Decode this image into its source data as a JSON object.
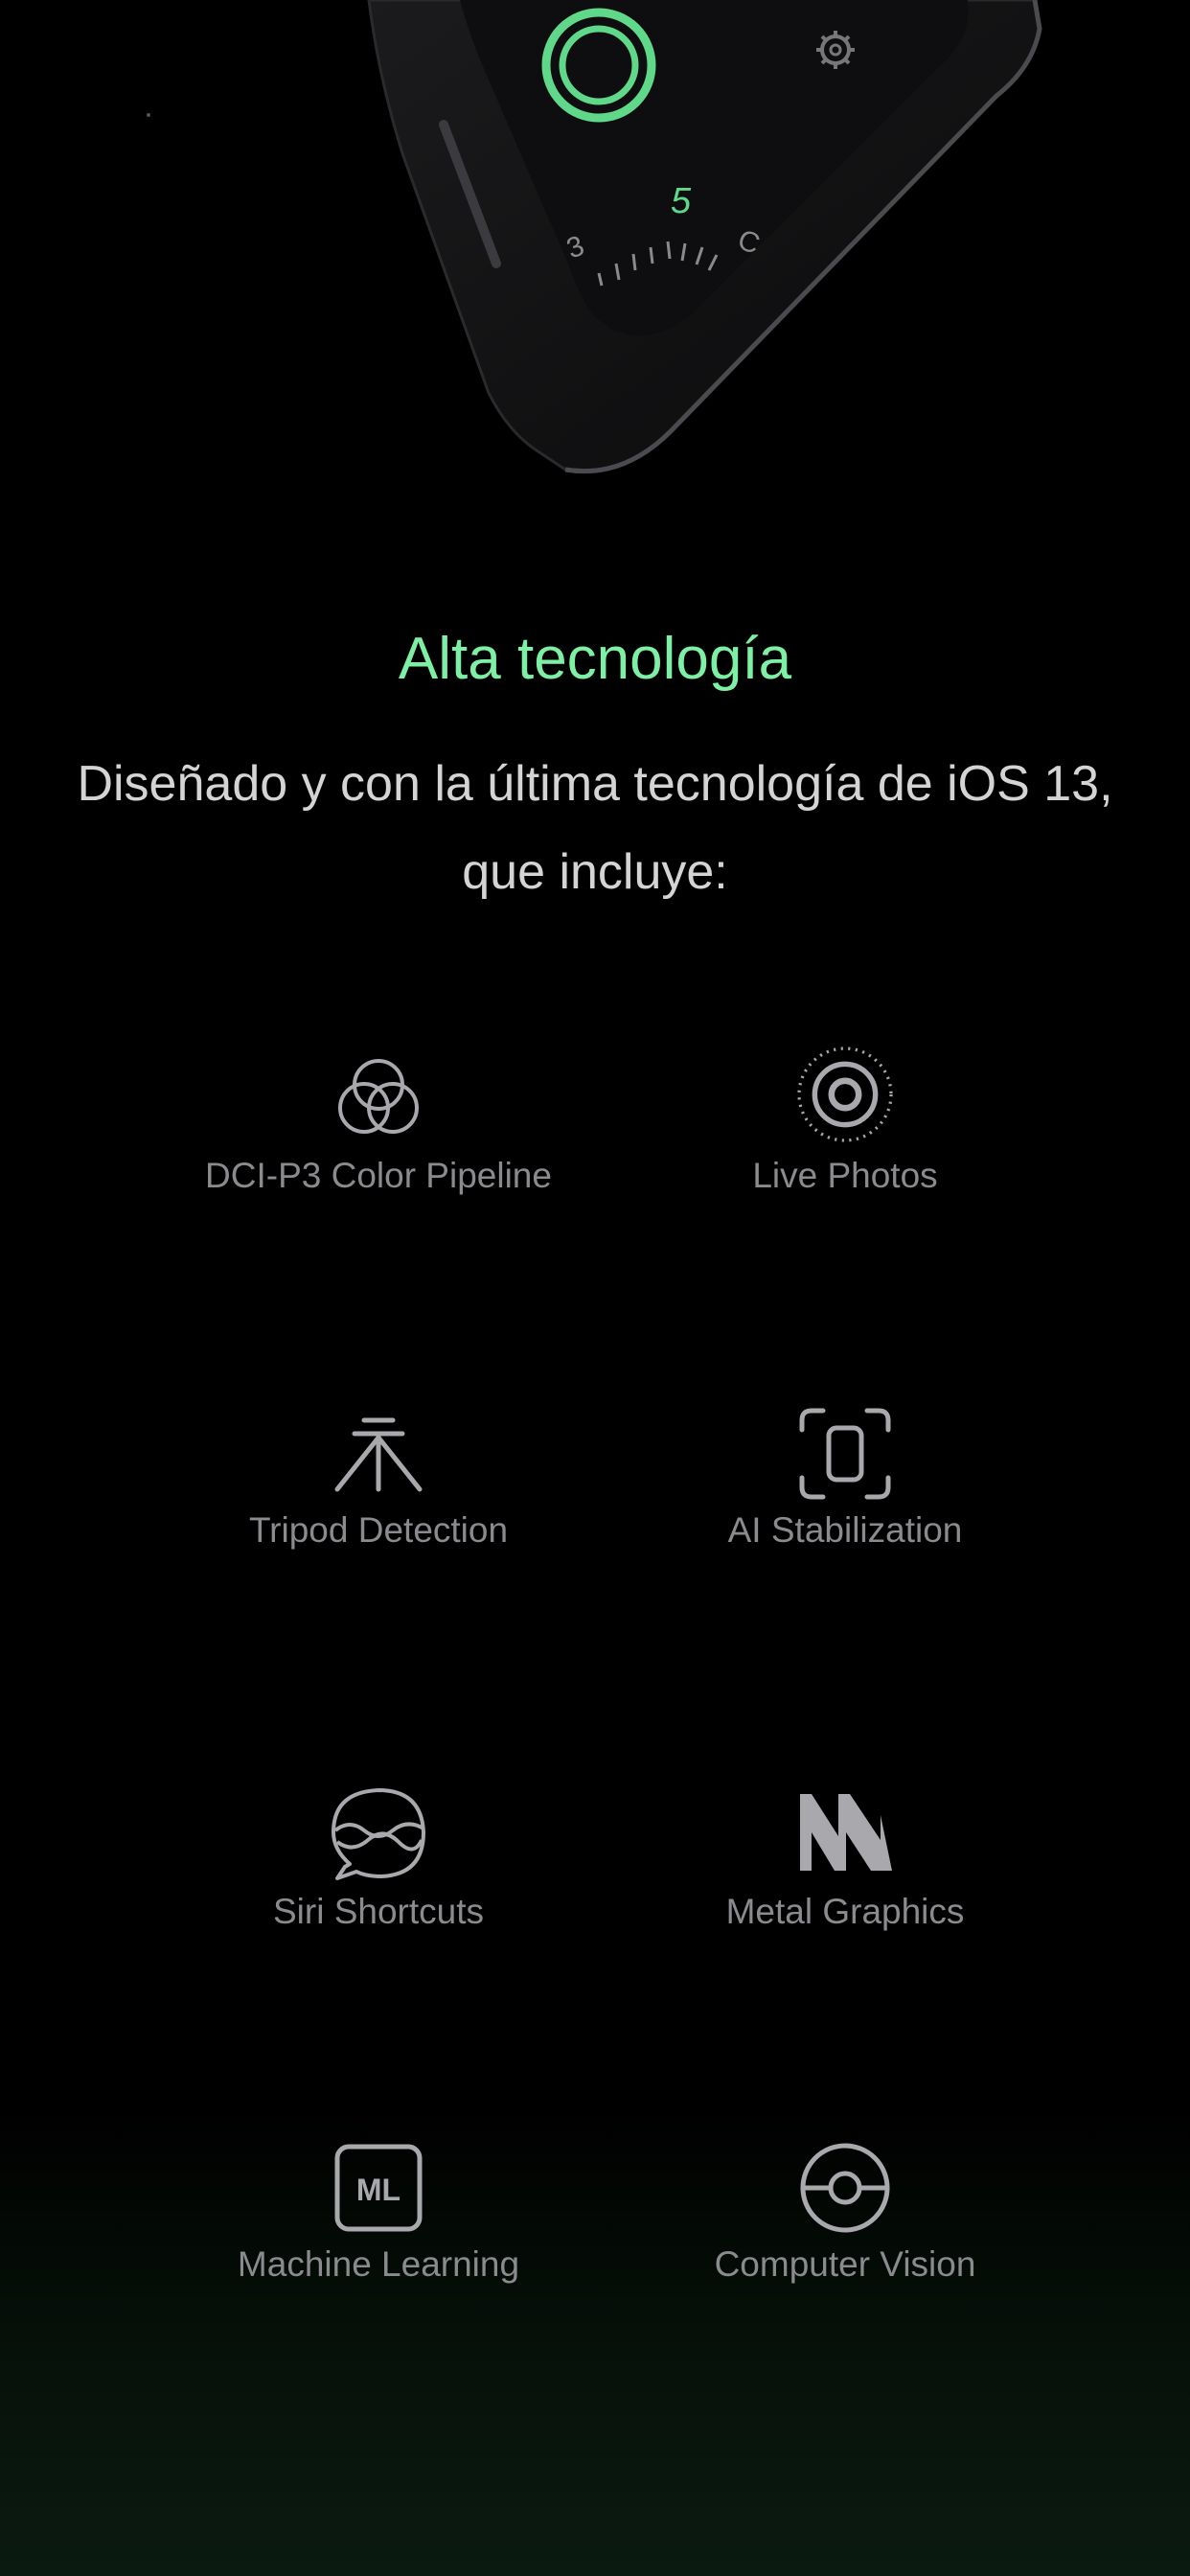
{
  "phone": {
    "dial_number": "5"
  },
  "section": {
    "heading": "Alta tecnología",
    "subtitle_line1": "Diseñado y con la última tecnología de iOS 13,",
    "subtitle_line2": "que incluye:"
  },
  "features": [
    {
      "label": "DCI-P3 Color Pipeline",
      "icon": "color-circles-icon"
    },
    {
      "label": "Live Photos",
      "icon": "live-photos-icon"
    },
    {
      "label": "Tripod Detection",
      "icon": "tripod-icon"
    },
    {
      "label": "AI Stabilization",
      "icon": "stabilization-icon"
    },
    {
      "label": "Siri Shortcuts",
      "icon": "siri-shortcuts-icon"
    },
    {
      "label": "Metal Graphics",
      "icon": "metal-icon"
    },
    {
      "label": "Machine Learning",
      "icon": "ml-icon",
      "icon_text": "ML"
    },
    {
      "label": "Computer Vision",
      "icon": "computer-vision-icon"
    }
  ],
  "colors": {
    "accent_green": "#7ef0a6",
    "icon_gray": "#a8a8ad",
    "label_gray": "#8a8a8f"
  }
}
